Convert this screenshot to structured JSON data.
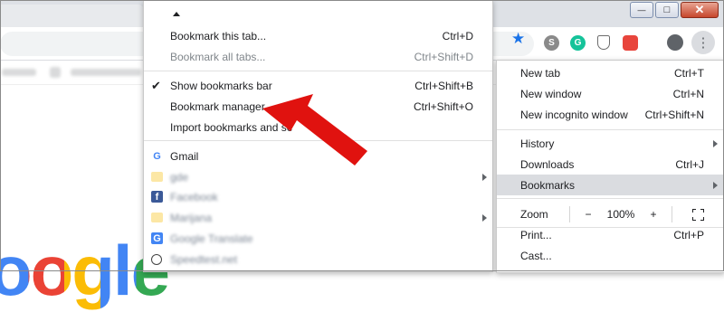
{
  "bookmarks_submenu": {
    "items": [
      {
        "label": "Bookmark this tab...",
        "shortcut": "Ctrl+D"
      },
      {
        "label": "Bookmark all tabs...",
        "shortcut": "Ctrl+Shift+D"
      },
      {
        "label": "Show bookmarks bar",
        "shortcut": "Ctrl+Shift+B",
        "checked": true
      },
      {
        "label": "Bookmark manager",
        "shortcut": "Ctrl+Shift+O"
      },
      {
        "label": "Import bookmarks and se"
      }
    ],
    "bookmarks": [
      {
        "label": "Gmail"
      },
      {
        "label": "gde"
      },
      {
        "label": "Facebook"
      },
      {
        "label": "Marijana"
      },
      {
        "label": "Google Translate"
      },
      {
        "label": "Speedtest.net"
      }
    ]
  },
  "chrome_menu": {
    "items": [
      {
        "label": "New tab",
        "shortcut": "Ctrl+T"
      },
      {
        "label": "New window",
        "shortcut": "Ctrl+N"
      },
      {
        "label": "New incognito window",
        "shortcut": "Ctrl+Shift+N"
      },
      {
        "label": "History"
      },
      {
        "label": "Downloads",
        "shortcut": "Ctrl+J"
      },
      {
        "label": "Bookmarks"
      },
      {
        "label": "Print...",
        "shortcut": "Ctrl+P"
      },
      {
        "label": "Cast..."
      }
    ],
    "zoom": {
      "label": "Zoom",
      "minus": "−",
      "value": "100%",
      "plus": "+"
    }
  },
  "window_controls": {
    "minimize": "—",
    "maximize": "□",
    "close": "✕"
  },
  "toolbar": {
    "menu_glyph": "⋮"
  },
  "page": {
    "logo": "oogle"
  },
  "icons": {
    "gmail": "google-g-icon",
    "facebook": "facebook-f-icon",
    "translate": "google-translate-icon",
    "speedtest": "speedometer-icon",
    "folder": "folder-icon",
    "star": "bookmark-star-icon",
    "avatar": "profile-avatar-icon"
  },
  "colors": {
    "highlight": "#dadce0",
    "star": "#1a73e8",
    "annotation_arrow": "#e0120f"
  }
}
